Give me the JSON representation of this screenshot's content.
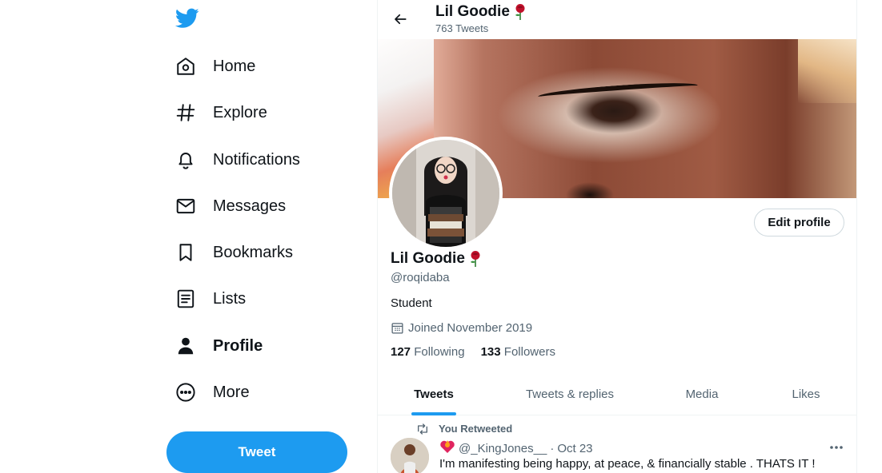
{
  "nav": {
    "items": [
      {
        "label": "Home",
        "icon": "home-icon"
      },
      {
        "label": "Explore",
        "icon": "hashtag-icon"
      },
      {
        "label": "Notifications",
        "icon": "bell-icon"
      },
      {
        "label": "Messages",
        "icon": "envelope-icon"
      },
      {
        "label": "Bookmarks",
        "icon": "bookmark-icon"
      },
      {
        "label": "Lists",
        "icon": "list-icon"
      },
      {
        "label": "Profile",
        "icon": "person-icon",
        "active": true
      },
      {
        "label": "More",
        "icon": "more-circle-icon"
      }
    ],
    "tweet_label": "Tweet"
  },
  "header": {
    "name": "Lil Goodie",
    "tweet_count": "763 Tweets"
  },
  "profile": {
    "name": "Lil Goodie",
    "handle": "@roqidaba",
    "bio": "Student",
    "joined": "Joined November 2019",
    "following_count": "127",
    "following_label": "Following",
    "followers_count": "133",
    "followers_label": "Followers",
    "edit_label": "Edit profile"
  },
  "tabs": [
    {
      "label": "Tweets",
      "active": true
    },
    {
      "label": "Tweets & replies"
    },
    {
      "label": "Media"
    },
    {
      "label": "Likes"
    }
  ],
  "tweet": {
    "retweet_label": "You Retweeted",
    "handle": "@_KingJones__",
    "separator": "·",
    "date": "Oct 23",
    "text": "I'm manifesting being happy, at peace, & financially stable . THATS IT !"
  },
  "colors": {
    "accent": "#1d9bf0",
    "text": "#0f1419",
    "muted": "#536471",
    "border": "#eff3f4",
    "rose": "#c0102a"
  }
}
